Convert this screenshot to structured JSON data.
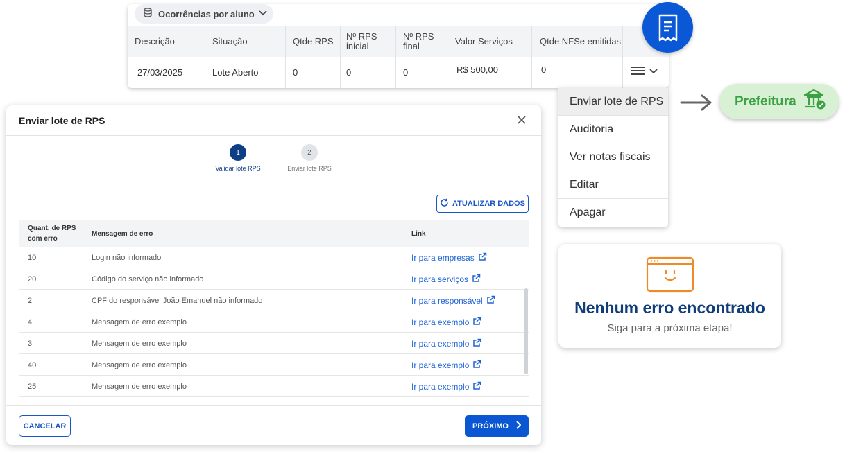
{
  "top_table": {
    "group_label": "Ocorrências por aluno",
    "headers": {
      "descricao": "Descrição",
      "situacao": "Situação",
      "qtde_rps": "Qtde RPS",
      "rps_inicial_1": "Nº RPS",
      "rps_inicial_2": "inicial",
      "rps_final_1": "Nº RPS",
      "rps_final_2": "final",
      "valor_servicos": "Valor Serviços",
      "qtde_nfse": "Qtde NFSe emitidas"
    },
    "row": {
      "descricao": "27/03/2025",
      "situacao": "Lote Aberto",
      "qtde_rps": "0",
      "rps_inicial": "0",
      "rps_final": "0",
      "valor_servicos": "R$ 500,00",
      "qtde_nfse": "0"
    }
  },
  "actions_menu": {
    "items": [
      "Enviar lote de RPS",
      "Auditoria",
      "Ver notas fiscais",
      "Editar",
      "Apagar"
    ],
    "active_index": 0
  },
  "prefeitura": {
    "label": "Prefeitura",
    "color": "#3ba144"
  },
  "modal": {
    "title": "Enviar lote de RPS",
    "steps": [
      {
        "number": "1",
        "label": "Validar lote RPS",
        "state": "active"
      },
      {
        "number": "2",
        "label": "Enviar lote RPS",
        "state": "pending"
      }
    ],
    "refresh_label": "ATUALIZAR DADOS",
    "error_table": {
      "headers": {
        "qty_line1": "Quant. de RPS",
        "qty_line2": "com erro",
        "message": "Mensagem de erro",
        "link": "Link"
      },
      "rows": [
        {
          "qty": "10",
          "message": "Login não informado",
          "link": "Ir para empresas"
        },
        {
          "qty": "20",
          "message": "Código do serviço não informado",
          "link": "Ir para serviços"
        },
        {
          "qty": "2",
          "message": "CPF do responsável João Emanuel não informado",
          "link": "Ir para responsável"
        },
        {
          "qty": "4",
          "message": "Mensagem de erro exemplo",
          "link": "Ir para exemplo"
        },
        {
          "qty": "3",
          "message": "Mensagem de erro exemplo",
          "link": "Ir para exemplo"
        },
        {
          "qty": "40",
          "message": "Mensagem de erro exemplo",
          "link": "Ir para exemplo"
        },
        {
          "qty": "25",
          "message": "Mensagem de erro exemplo",
          "link": "Ir para exemplo"
        }
      ]
    },
    "cancel_label": "CANCELAR",
    "next_label": "PRÓXIMO"
  },
  "no_errors_card": {
    "title": "Nenhum erro encontrado",
    "subtitle": "Siga para a próxima etapa!"
  },
  "colors": {
    "primary": "#0b56d3",
    "step_active": "#0e3f84",
    "link": "#1d63d6",
    "ok_icon": "#f08a24"
  }
}
